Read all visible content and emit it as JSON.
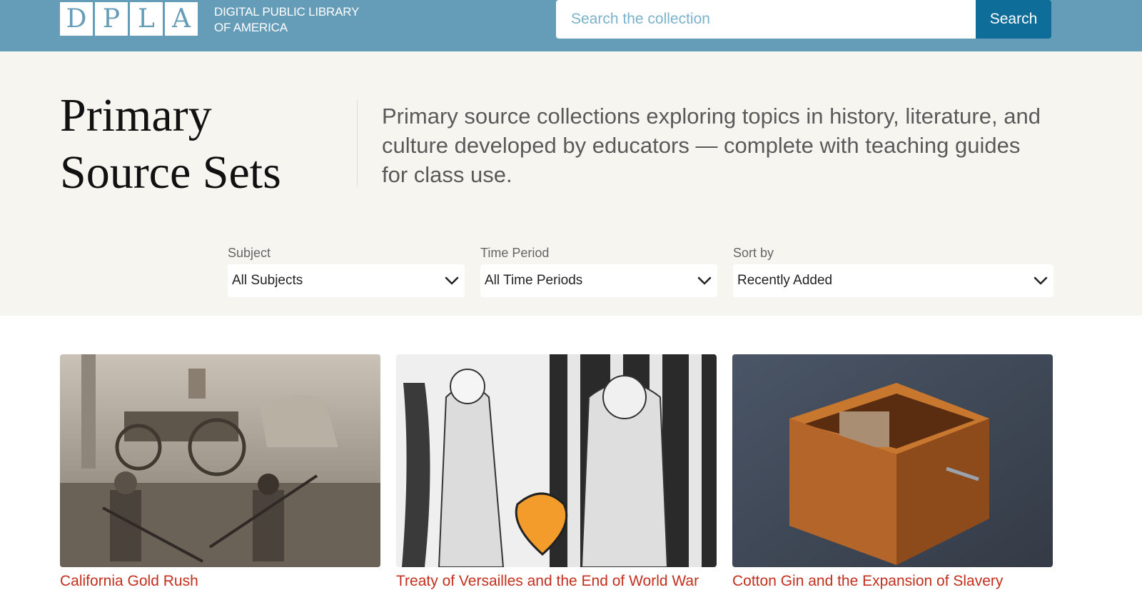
{
  "header": {
    "logo_letters": [
      "D",
      "P",
      "L",
      "A"
    ],
    "logo_line1": "DIGITAL PUBLIC LIBRARY",
    "logo_line2": "OF AMERICA",
    "search_placeholder": "Search the collection",
    "search_button": "Search"
  },
  "hero": {
    "title_line1": "Primary",
    "title_line2": "Source Sets",
    "description": "Primary source collections exploring topics in history, literature, and culture developed by educators — complete with teaching guides for class use."
  },
  "filters": [
    {
      "label": "Subject",
      "value": "All Subjects"
    },
    {
      "label": "Time Period",
      "value": "All Time Periods"
    },
    {
      "label": "Sort by",
      "value": "Recently Added"
    }
  ],
  "cards": [
    {
      "title": "California Gold Rush"
    },
    {
      "title": "Treaty of Versailles and the End of World War"
    },
    {
      "title": "Cotton Gin and the Expansion of Slavery"
    }
  ],
  "colors": {
    "header_bg": "#659db9",
    "search_button_bg": "#0e6d99",
    "hero_bg": "#f7f5f0",
    "card_title": "#c3301e"
  }
}
